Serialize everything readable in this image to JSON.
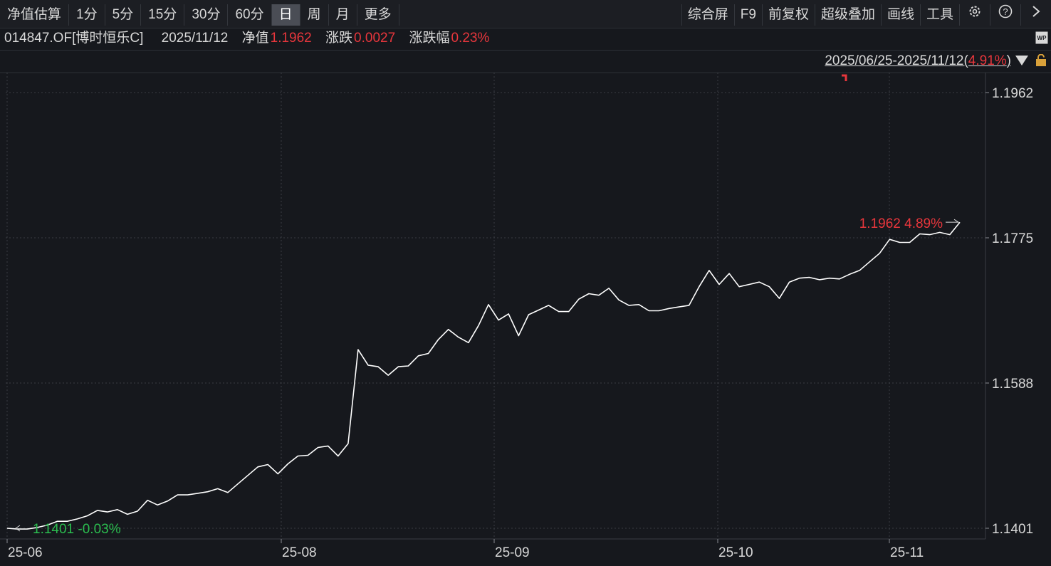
{
  "toolbar": {
    "periods": [
      "净值估算",
      "1分",
      "5分",
      "15分",
      "30分",
      "60分",
      "日",
      "周",
      "月",
      "更多"
    ],
    "active_period": "日",
    "right_items": [
      "综合屏",
      "F9",
      "前复权",
      "超级叠加",
      "画线",
      "工具"
    ],
    "icons": [
      "gear-icon",
      "help-icon",
      "chevron-right-icon"
    ]
  },
  "info": {
    "code": "014847.OF[博时恒乐C]",
    "date": "2025/11/12",
    "nav_label": "净值",
    "nav_value": "1.1962",
    "change_label": "涨跌",
    "change_value": "0.0027",
    "pct_label": "涨跌幅",
    "pct_value": "0.23%"
  },
  "range": {
    "text": "2025/06/25-2025/11/12",
    "pct": "4.91%"
  },
  "colors": {
    "background": "#16181d",
    "line": "#ffffff",
    "up": "#e8363c",
    "down": "#2bbd4f",
    "grid": "#3a3d44"
  },
  "chart_data": {
    "type": "line",
    "x_ticks": [
      "25-06",
      "25-08",
      "25-09",
      "25-10",
      "25-11"
    ],
    "y_ticks": [
      "1.1962",
      "1.1775",
      "1.1588",
      "1.1401"
    ],
    "ylim": [
      1.1401,
      1.1962
    ],
    "max_label": "1.1962 4.89%",
    "min_label": "1.1401 -0.03%",
    "series": [
      {
        "values": [
          1.1401,
          1.14,
          1.14,
          1.1402,
          1.1405,
          1.141,
          1.141,
          1.1413,
          1.1417,
          1.1424,
          1.1422,
          1.1425,
          1.1419,
          1.1423,
          1.1437,
          1.1431,
          1.1436,
          1.1444,
          1.1444,
          1.1446,
          1.1448,
          1.1452,
          1.1447,
          1.1458,
          1.1469,
          1.148,
          1.1483,
          1.1471,
          1.1484,
          1.1494,
          1.1495,
          1.1505,
          1.1507,
          1.1494,
          1.151,
          1.1631,
          1.1611,
          1.1609,
          1.1598,
          1.1609,
          1.161,
          1.1623,
          1.1626,
          1.1644,
          1.1657,
          1.1647,
          1.164,
          1.1662,
          1.1689,
          1.1669,
          1.1677,
          1.1649,
          1.1676,
          1.1682,
          1.1688,
          1.168,
          1.168,
          1.1696,
          1.1703,
          1.1701,
          1.171,
          1.1695,
          1.1688,
          1.1689,
          1.1681,
          1.1681,
          1.1684,
          1.1686,
          1.1688,
          1.1712,
          1.1733,
          1.1715,
          1.1729,
          1.1712,
          1.1715,
          1.1718,
          1.1712,
          1.1697,
          1.1718,
          1.1723,
          1.1724,
          1.1721,
          1.1723,
          1.1722,
          1.1728,
          1.1733,
          1.1744,
          1.1755,
          1.1773,
          1.1769,
          1.1769,
          1.178,
          1.1779,
          1.1782,
          1.1779,
          1.1795
        ]
      }
    ],
    "grid": true
  }
}
